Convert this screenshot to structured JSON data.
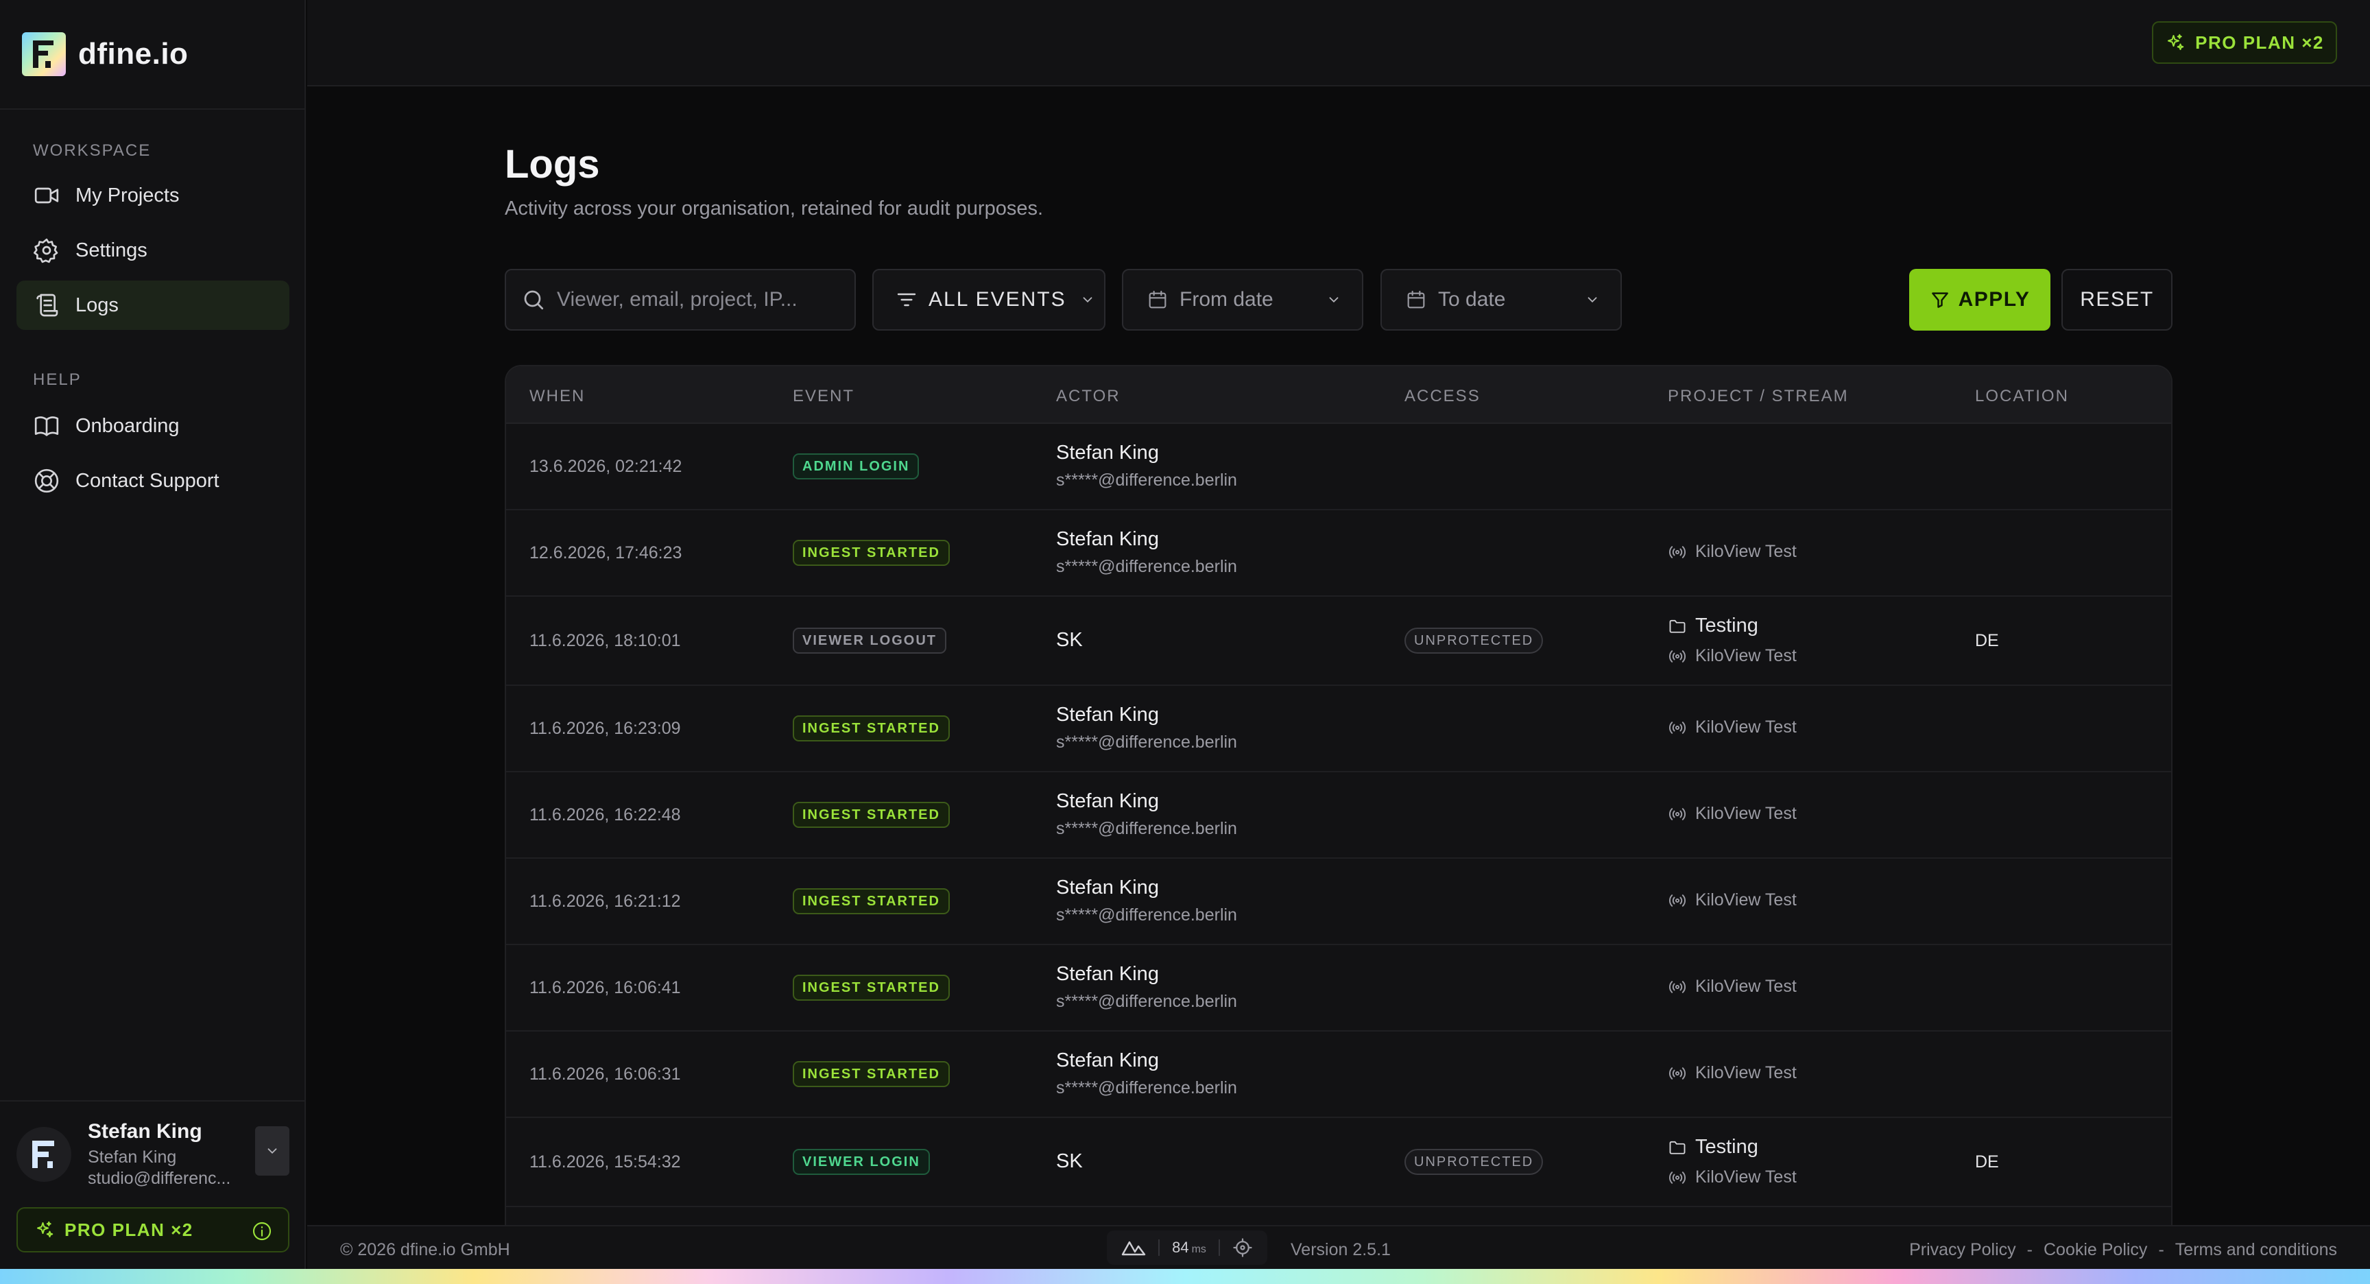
{
  "brand": {
    "name": "dfine.io"
  },
  "sidebar": {
    "workspace_label": "WORKSPACE",
    "workspace_items": [
      {
        "label": "My Projects",
        "icon": "video-camera-icon"
      },
      {
        "label": "Settings",
        "icon": "gear-icon"
      },
      {
        "label": "Logs",
        "icon": "logs-icon",
        "active": true
      }
    ],
    "help_label": "HELP",
    "help_items": [
      {
        "label": "Onboarding",
        "icon": "book-icon"
      },
      {
        "label": "Contact Support",
        "icon": "lifebuoy-icon"
      }
    ],
    "user": {
      "name": "Stefan King",
      "full_name": "Stefan King",
      "email": "studio@differenc..."
    },
    "plan_badge": "PRO PLAN ×2"
  },
  "topbar": {
    "plan_badge": "PRO PLAN ×2"
  },
  "page": {
    "title": "Logs",
    "subtitle": "Activity across your organisation, retained for audit purposes."
  },
  "filters": {
    "search_placeholder": "Viewer, email, project, IP...",
    "events_label": "ALL EVENTS",
    "from_label": "From date",
    "to_label": "To date",
    "apply_label": "APPLY",
    "reset_label": "RESET"
  },
  "table": {
    "columns": [
      "WHEN",
      "EVENT",
      "ACTOR",
      "ACCESS",
      "PROJECT / STREAM",
      "LOCATION"
    ],
    "rows": [
      {
        "when": "13.6.2026, 02:21:42",
        "event": "ADMIN LOGIN",
        "actor_name": "Stefan King",
        "actor_email": "s*****@difference.berlin",
        "access": "",
        "project": "",
        "stream": "",
        "location": ""
      },
      {
        "when": "12.6.2026, 17:46:23",
        "event": "INGEST STARTED",
        "actor_name": "Stefan King",
        "actor_email": "s*****@difference.berlin",
        "access": "",
        "project": "",
        "stream": "KiloView Test",
        "location": ""
      },
      {
        "when": "11.6.2026, 18:10:01",
        "event": "VIEWER LOGOUT",
        "actor_name": "SK",
        "actor_email": "",
        "access": "UNPROTECTED",
        "project": "Testing",
        "stream": "KiloView Test",
        "location": "DE"
      },
      {
        "when": "11.6.2026, 16:23:09",
        "event": "INGEST STARTED",
        "actor_name": "Stefan King",
        "actor_email": "s*****@difference.berlin",
        "access": "",
        "project": "",
        "stream": "KiloView Test",
        "location": ""
      },
      {
        "when": "11.6.2026, 16:22:48",
        "event": "INGEST STARTED",
        "actor_name": "Stefan King",
        "actor_email": "s*****@difference.berlin",
        "access": "",
        "project": "",
        "stream": "KiloView Test",
        "location": ""
      },
      {
        "when": "11.6.2026, 16:21:12",
        "event": "INGEST STARTED",
        "actor_name": "Stefan King",
        "actor_email": "s*****@difference.berlin",
        "access": "",
        "project": "",
        "stream": "KiloView Test",
        "location": ""
      },
      {
        "when": "11.6.2026, 16:06:41",
        "event": "INGEST STARTED",
        "actor_name": "Stefan King",
        "actor_email": "s*****@difference.berlin",
        "access": "",
        "project": "",
        "stream": "KiloView Test",
        "location": ""
      },
      {
        "when": "11.6.2026, 16:06:31",
        "event": "INGEST STARTED",
        "actor_name": "Stefan King",
        "actor_email": "s*****@difference.berlin",
        "access": "",
        "project": "",
        "stream": "KiloView Test",
        "location": ""
      },
      {
        "when": "11.6.2026, 15:54:32",
        "event": "VIEWER LOGIN",
        "actor_name": "SK",
        "actor_email": "",
        "access": "UNPROTECTED",
        "project": "Testing",
        "stream": "KiloView Test",
        "location": "DE"
      }
    ]
  },
  "footer": {
    "copyright": "© 2026 dfine.io GmbH",
    "latency_value": "84",
    "latency_unit": "ms",
    "version": "Version 2.5.1",
    "links": [
      "Privacy Policy",
      "Cookie Policy",
      "Terms and conditions"
    ],
    "link_separator": "-"
  },
  "colors": {
    "accent": "#84cc16",
    "background": "#0b0b0c",
    "sidebar": "#121214"
  }
}
